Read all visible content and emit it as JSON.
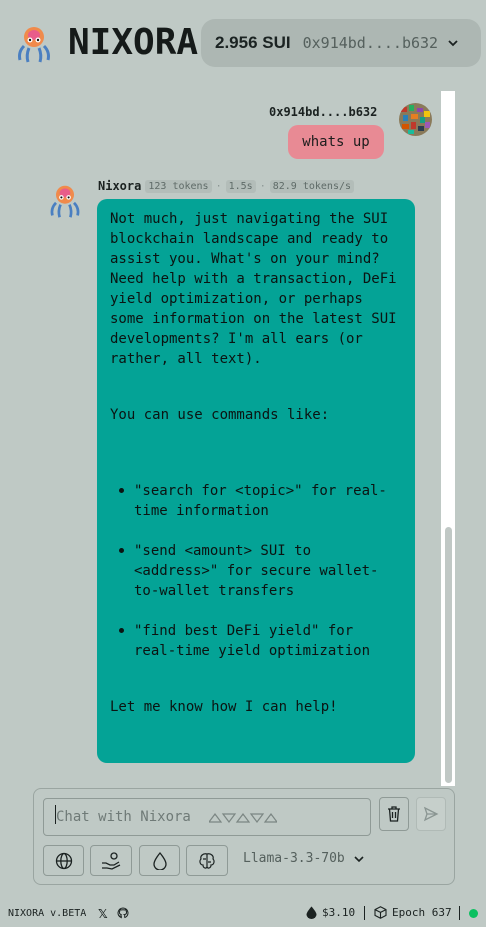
{
  "header": {
    "brand": "NIXORA",
    "balance": "2.956 SUI",
    "address": "0x914bd....b632"
  },
  "messages": {
    "user": {
      "label": "0x914bd....b632",
      "text": "whats up"
    },
    "bot": {
      "name": "Nixora",
      "tokens": "123 tokens",
      "time": "1.5s",
      "speed": "82.9 tokens/s",
      "p1": "Not much, just navigating the SUI blockchain landscape and ready to assist you. What's on your mind? Need help with a transaction, DeFi yield optimization, or perhaps some information on the latest SUI developments? I'm all ears (or rather, all text).",
      "p2": "You can use commands like:",
      "list": [
        "\"search for <topic>\" for real-time information",
        "\"send <amount> SUI to <address>\" for secure wallet-to-wallet transfers",
        "\"find best DeFi yield\" for real-time yield optimization"
      ],
      "p3": "Let me know how I can help!"
    }
  },
  "composer": {
    "placeholder": "Chat with Nixora",
    "model": "Llama-3.3-70b"
  },
  "footer": {
    "version": "NIXORA v.BETA",
    "x": "𝕏",
    "price": "$3.10",
    "epoch": "Epoch 637"
  },
  "colors": {
    "background": "#bfc9c5",
    "bot_bubble": "#04a396",
    "user_bubble": "#e88a94",
    "status": "#0bc060"
  }
}
